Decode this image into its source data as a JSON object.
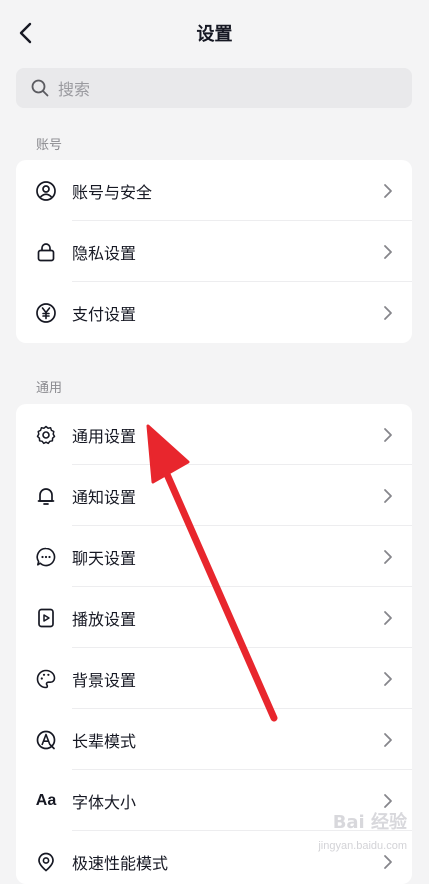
{
  "header": {
    "title": "设置"
  },
  "search": {
    "placeholder": "搜索"
  },
  "sections": [
    {
      "label": "账号",
      "items": [
        {
          "label": "账号与安全",
          "icon": "account-security-icon"
        },
        {
          "label": "隐私设置",
          "icon": "lock-icon"
        },
        {
          "label": "支付设置",
          "icon": "yuan-icon"
        }
      ]
    },
    {
      "label": "通用",
      "items": [
        {
          "label": "通用设置",
          "icon": "gear-icon"
        },
        {
          "label": "通知设置",
          "icon": "bell-icon"
        },
        {
          "label": "聊天设置",
          "icon": "chat-bubble-icon"
        },
        {
          "label": "播放设置",
          "icon": "play-icon"
        },
        {
          "label": "背景设置",
          "icon": "palette-icon"
        },
        {
          "label": "长辈模式",
          "icon": "elder-mode-icon"
        },
        {
          "label": "字体大小",
          "icon": "font-size-icon",
          "glyph": "Aa"
        },
        {
          "label": "极速性能模式",
          "icon": "speed-mode-icon"
        }
      ]
    }
  ],
  "colors": {
    "background": "#f4f4f5",
    "card": "#ffffff",
    "annotation_arrow": "#e8262d"
  },
  "watermark": {
    "text": "Bai 经验",
    "sub": "jingyan.baidu.com"
  }
}
